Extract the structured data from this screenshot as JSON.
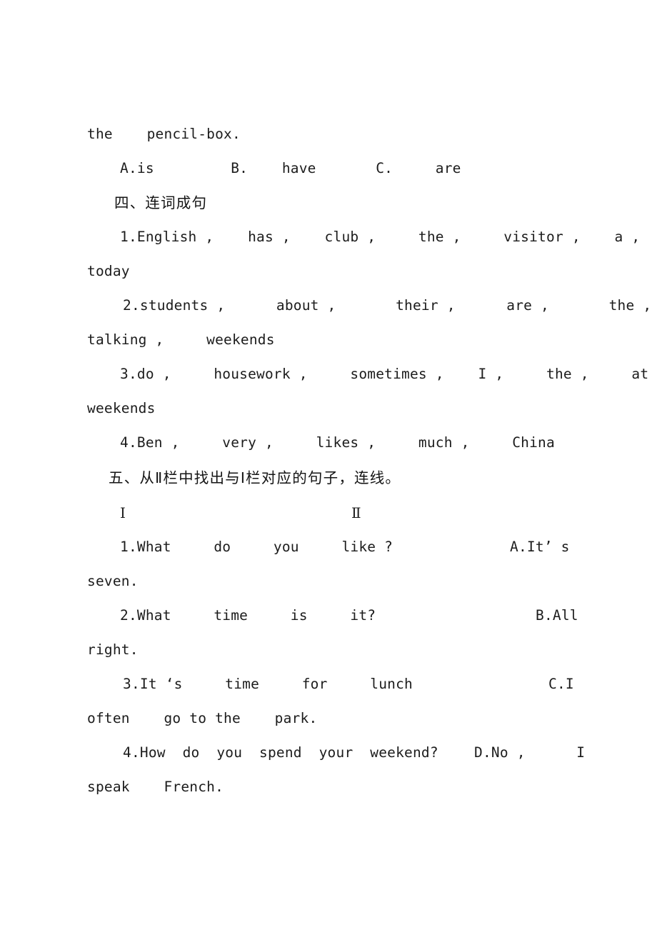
{
  "document": {
    "kind": "scanned-worksheet",
    "page_background": "#ffffff",
    "text_color": "#1c1c1c"
  },
  "carryover": {
    "line1": "the    pencil-box.",
    "options": "A.is         B.    have       C.     are"
  },
  "section_four": {
    "heading": "四、连词成句",
    "items": [
      {
        "line1": "1.English ,    has ,    club ,     the ,     visitor ,    a ,",
        "line2": "today"
      },
      {
        "line1": "2.students ,      about ,       their ,      are ,       the ,",
        "line2": "talking ,     weekends"
      },
      {
        "line1": "3.do ,     housework ,     sometimes ,    I ,     the ,     at ,",
        "line2": "weekends"
      },
      {
        "line1": "4.Ben ,     very ,     likes ,     much ,     China",
        "line2": ""
      }
    ]
  },
  "section_five": {
    "heading": "五、从Ⅱ栏中找出与Ⅰ栏对应的句子，连线。",
    "column_headers": {
      "left": "Ⅰ",
      "right": "Ⅱ"
    },
    "pairs": [
      {
        "left": "1.What     do     you     like ?",
        "right": "A.It’ s",
        "wrap": "seven."
      },
      {
        "left": "2.What     time     is     it?",
        "right": "B.All",
        "wrap": "right."
      },
      {
        "left": "3.It ‘s     time     for     lunch",
        "right": "C.I",
        "wrap": "often    go to the    park."
      },
      {
        "left": "4.How  do  you  spend  your  weekend?",
        "right": "D.No ,      I",
        "wrap": "speak    French."
      }
    ]
  }
}
